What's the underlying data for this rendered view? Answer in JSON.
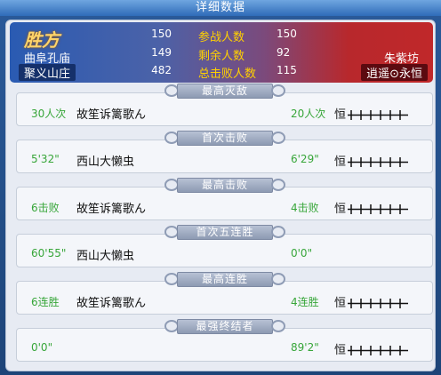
{
  "window": {
    "title": "详细数据"
  },
  "header": {
    "win_label": "胜方",
    "left_team": [
      "曲阜孔庙",
      "聚义山庄"
    ],
    "right_team": [
      "朱紫坊",
      "逍遥⊙永恒"
    ],
    "stats": [
      {
        "left": "150",
        "label": "参战人数",
        "right": "150"
      },
      {
        "left": "149",
        "label": "剩余人数",
        "right": "92"
      },
      {
        "left": "482",
        "label": "总击败人数",
        "right": "115"
      }
    ]
  },
  "records": [
    {
      "title": "最高灭敌",
      "left_value": "30人次",
      "left_name": "故笙诉篱歌ん",
      "right_value": "20人次",
      "right_name": "恒",
      "right_rank_bars": 6
    },
    {
      "title": "首次击败",
      "left_value": "5'32\"",
      "left_name": "西山大懒虫",
      "right_value": "6'29\"",
      "right_name": "恒",
      "right_rank_bars": 6
    },
    {
      "title": "最高击败",
      "left_value": "6击败",
      "left_name": "故笙诉篱歌ん",
      "right_value": "4击败",
      "right_name": "恒",
      "right_rank_bars": 6
    },
    {
      "title": "首次五连胜",
      "left_value": "60'55\"",
      "left_name": "西山大懒虫",
      "right_value": "0'0\"",
      "right_name": "",
      "right_rank_bars": 0
    },
    {
      "title": "最高连胜",
      "left_value": "6连胜",
      "left_name": "故笙诉篱歌ん",
      "right_value": "4连胜",
      "right_name": "恒",
      "right_rank_bars": 6
    },
    {
      "title": "最强终结者",
      "left_value": "0'0\"",
      "left_name": "",
      "right_value": "89'2\"",
      "right_name": "恒",
      "right_rank_bars": 6
    }
  ],
  "colors": {
    "value_green": "#38a63a",
    "stat_label_yellow": "#ffd000",
    "win_gold": "#ffd46a"
  }
}
